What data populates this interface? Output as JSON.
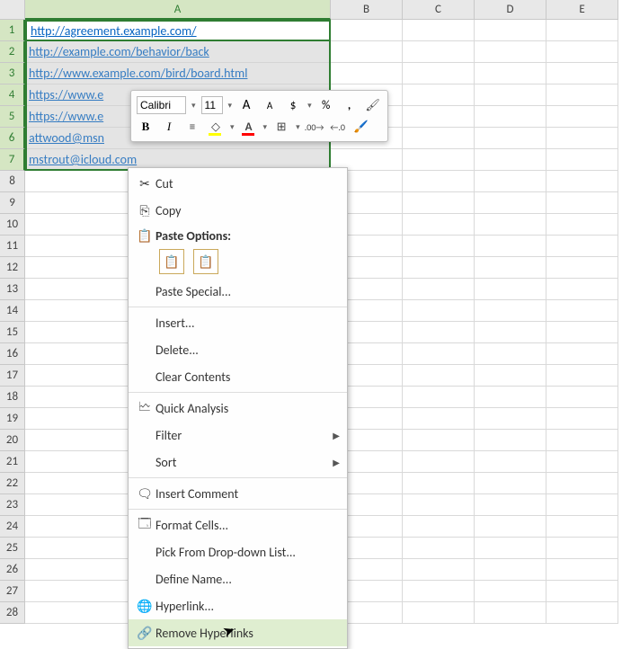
{
  "columns": [
    "A",
    "B",
    "C",
    "D",
    "E"
  ],
  "rows": [
    "1",
    "2",
    "3",
    "4",
    "5",
    "6",
    "7",
    "8",
    "9",
    "10",
    "11",
    "12",
    "13",
    "14",
    "15",
    "16",
    "17",
    "18",
    "19",
    "20",
    "21",
    "22",
    "23",
    "24",
    "25",
    "26",
    "27",
    "28"
  ],
  "cells": {
    "A1": "http://agreement.example.com/",
    "A2": "http://example.com/behavior/back",
    "A3": "http://www.example.com/bird/board.html",
    "A4": "https://www.e",
    "A5": "https://www.e",
    "A6": "attwood@msn",
    "A7": "mstrout@icloud.com"
  },
  "miniToolbar": {
    "font": "Calibri",
    "size": "11",
    "increaseFont": "A",
    "decreaseFont": "A",
    "accounting": "$",
    "percent": "%",
    "comma": ",",
    "bold": "B",
    "italic": "I"
  },
  "contextMenu": {
    "cut": "Cut",
    "copy": "Copy",
    "pasteOptionsLabel": "Paste Options:",
    "pasteSpecial": "Paste Special...",
    "insert": "Insert...",
    "delete": "Delete...",
    "clearContents": "Clear Contents",
    "quickAnalysis": "Quick Analysis",
    "filter": "Filter",
    "sort": "Sort",
    "insertComment": "Insert Comment",
    "formatCells": "Format Cells...",
    "pickFromList": "Pick From Drop-down List...",
    "defineName": "Define Name...",
    "hyperlink": "Hyperlink...",
    "removeHyperlinks": "Remove Hyperlinks"
  }
}
